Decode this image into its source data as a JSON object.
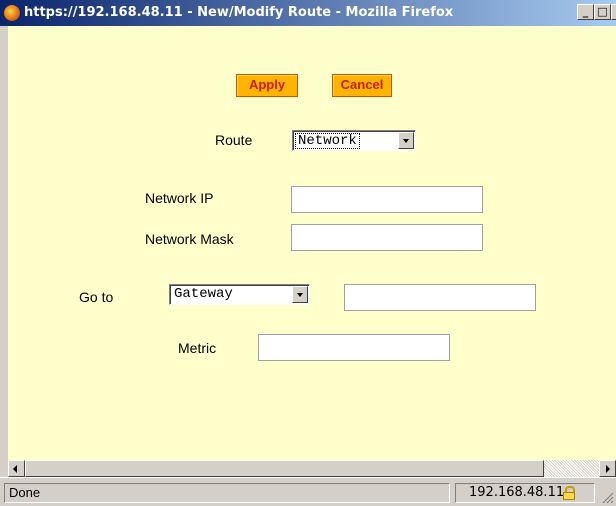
{
  "window": {
    "title": "https://192.168.48.11 - New/Modify Route - Mozilla Firefox",
    "minimize_glyph": "_",
    "maximize_glyph": "□",
    "close_glyph": "×"
  },
  "form": {
    "apply_label": "Apply",
    "cancel_label": "Cancel",
    "route_label": "Route",
    "route_value": "Network",
    "network_ip_label": "Network IP",
    "network_ip_value": "",
    "network_mask_label": "Network Mask",
    "network_mask_value": "",
    "goto_label": "Go to",
    "goto_value": "Gateway",
    "gateway_value": "",
    "metric_label": "Metric",
    "metric_value": ""
  },
  "status": {
    "text": "Done",
    "host": "192.168.48.11"
  },
  "colors": {
    "page_background": "#ffffcc",
    "button_background": "#ffb400",
    "button_text": "#c81e00",
    "title_bar_start": "#0a246a",
    "title_bar_end": "#a6caf0"
  }
}
